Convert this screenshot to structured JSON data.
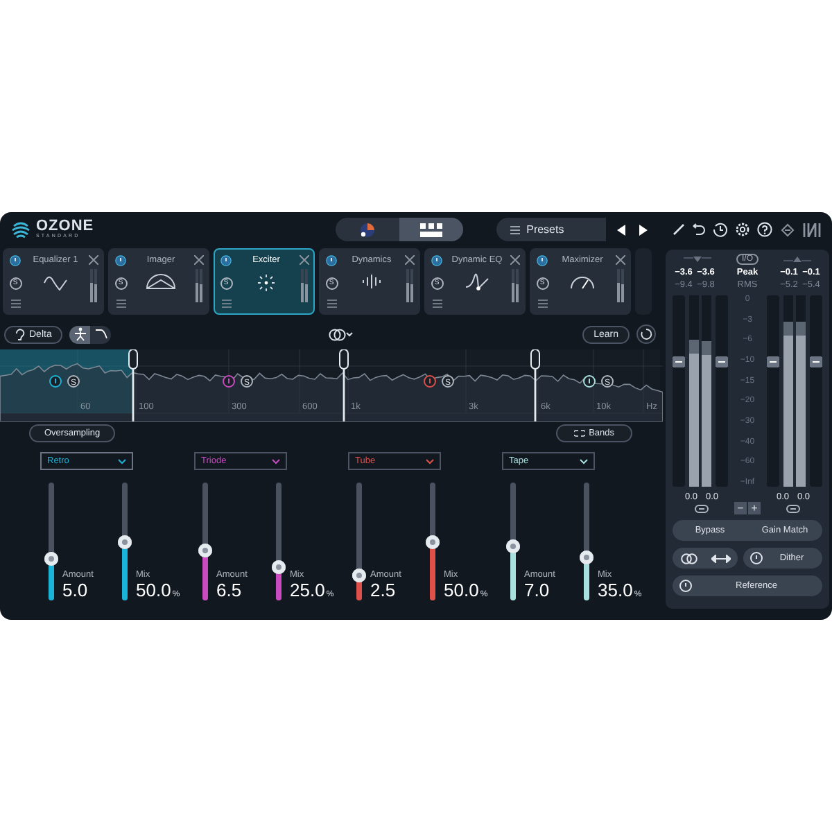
{
  "header": {
    "logo": "OZONE",
    "edition": "STANDARD",
    "views": [
      {
        "kind": "tone",
        "selected": false
      },
      {
        "kind": "modules",
        "selected": true
      }
    ],
    "presets": "Presets"
  },
  "modules": [
    {
      "name": "Equalizer 1",
      "kind": "eq",
      "solo": "S",
      "selected": false
    },
    {
      "name": "Imager",
      "kind": "imager",
      "solo": "S",
      "selected": false
    },
    {
      "name": "Exciter",
      "kind": "exciter",
      "solo": "S",
      "selected": true
    },
    {
      "name": "Dynamics",
      "kind": "dynamics",
      "solo": "S",
      "selected": false
    },
    {
      "name": "Dynamic EQ",
      "kind": "dyneq",
      "solo": "S",
      "selected": false
    },
    {
      "name": "Maximizer",
      "kind": "maximizer",
      "solo": "S",
      "selected": false
    }
  ],
  "toolbar": {
    "delta": "Delta",
    "modes": [
      {
        "kind": "figure",
        "selected": true
      },
      {
        "kind": "curve",
        "selected": false
      }
    ],
    "learn": "Learn"
  },
  "spectrum": {
    "axis_labels": [
      "60",
      "100",
      "300",
      "600",
      "1k",
      "3k",
      "6k",
      "10k",
      "Hz"
    ]
  },
  "oversampling": "Oversampling",
  "bands_button": "Bands",
  "bands": [
    {
      "mode": "Retro",
      "color": "#1ab4d8",
      "selected": true,
      "solo": "S",
      "amount": {
        "label": "Amount",
        "value": "5.0",
        "level": 0.33
      },
      "mix": {
        "label": "Mix",
        "value": "50.0",
        "unit": "%",
        "level": 0.49
      }
    },
    {
      "mode": "Triode",
      "color": "#c94bbf",
      "selected": false,
      "solo": "S",
      "amount": {
        "label": "Amount",
        "value": "6.5",
        "level": 0.42
      },
      "mix": {
        "label": "Mix",
        "value": "25.0",
        "unit": "%",
        "level": 0.25
      }
    },
    {
      "mode": "Tube",
      "color": "#e0504a",
      "selected": false,
      "solo": "S",
      "amount": {
        "label": "Amount",
        "value": "2.5",
        "level": 0.18
      },
      "mix": {
        "label": "Mix",
        "value": "50.0",
        "unit": "%",
        "level": 0.49
      }
    },
    {
      "mode": "Tape",
      "color": "#a8e0e0",
      "selected": false,
      "solo": "S",
      "amount": {
        "label": "Amount",
        "value": "7.0",
        "level": 0.46
      },
      "mix": {
        "label": "Mix",
        "value": "35.0",
        "unit": "%",
        "level": 0.35
      }
    }
  ],
  "meters": {
    "io": "I/O",
    "peak_label": "Peak",
    "rms_label": "RMS",
    "groups": [
      {
        "peak": [
          "−3.6",
          "−3.6"
        ],
        "rms": [
          "−9.4",
          "−9.8"
        ],
        "bars": [
          {
            "level": 0.77
          },
          {
            "level": 0.76
          }
        ],
        "faders": [
          {
            "level": 0.66
          },
          {
            "level": 0.66
          }
        ],
        "readouts": [
          "0.0",
          "0.0"
        ]
      },
      {
        "peak": [
          "−0.1",
          "−0.1"
        ],
        "rms": [
          "−5.2",
          "−5.4"
        ],
        "bars": [
          {
            "level": 0.86
          },
          {
            "level": 0.86
          }
        ],
        "faders": [
          {
            "level": 0.66
          },
          {
            "level": 0.66
          }
        ],
        "readouts": [
          "0.0",
          "0.0"
        ]
      }
    ],
    "scale": [
      "0",
      "−3",
      "−6",
      "−10",
      "−15",
      "−20",
      "−30",
      "−40",
      "−60",
      "−Inf"
    ],
    "minus": "−",
    "plus": "+",
    "bypass": "Bypass",
    "gain_match": "Gain Match",
    "dither": "Dither",
    "reference": "Reference"
  }
}
